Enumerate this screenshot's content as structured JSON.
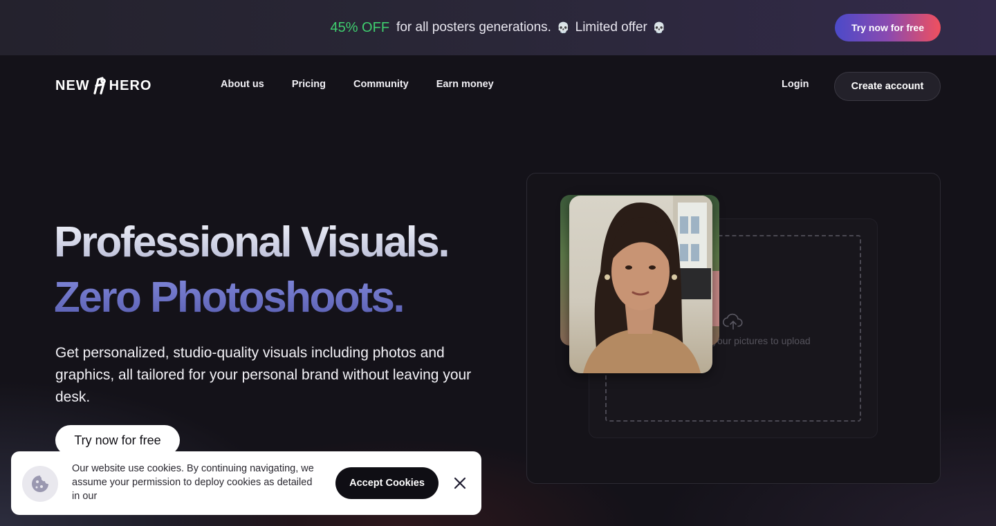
{
  "promo": {
    "discount": "45% OFF",
    "text": "for all posters generations.",
    "limited": "Limited offer",
    "skull_icon": "💀",
    "cta_label": "Try now for free",
    "colors": {
      "discount": "#3fcf6f",
      "cta_start": "#4b4ac9",
      "cta_end": "#f0505e"
    }
  },
  "nav": {
    "logo_left": "NEW",
    "logo_right": "HERO",
    "logo_icon": "hero-figure-icon",
    "items": [
      {
        "label": "About us"
      },
      {
        "label": "Pricing"
      },
      {
        "label": "Community"
      },
      {
        "label": "Earn money"
      }
    ],
    "login_label": "Login",
    "create_account_label": "Create account"
  },
  "hero": {
    "title_line1": "Professional Visuals.",
    "title_line2": "Zero Photoshoots.",
    "subtitle": "Get personalized, studio-quality visuals including photos and graphics, all tailored for your personal brand without leaving your desk.",
    "cta_label": "Try now for free",
    "colors": {
      "title_line2": "#6a70c6"
    }
  },
  "upload": {
    "icon": "cloud-upload-icon",
    "text": "your pictures to upload"
  },
  "cookie": {
    "icon": "cookie-icon",
    "text": "Our website use cookies. By continuing navigating, we assume your permission to deploy cookies as detailed in our",
    "accept_label": "Accept Cookies",
    "close_icon": "close-icon"
  }
}
